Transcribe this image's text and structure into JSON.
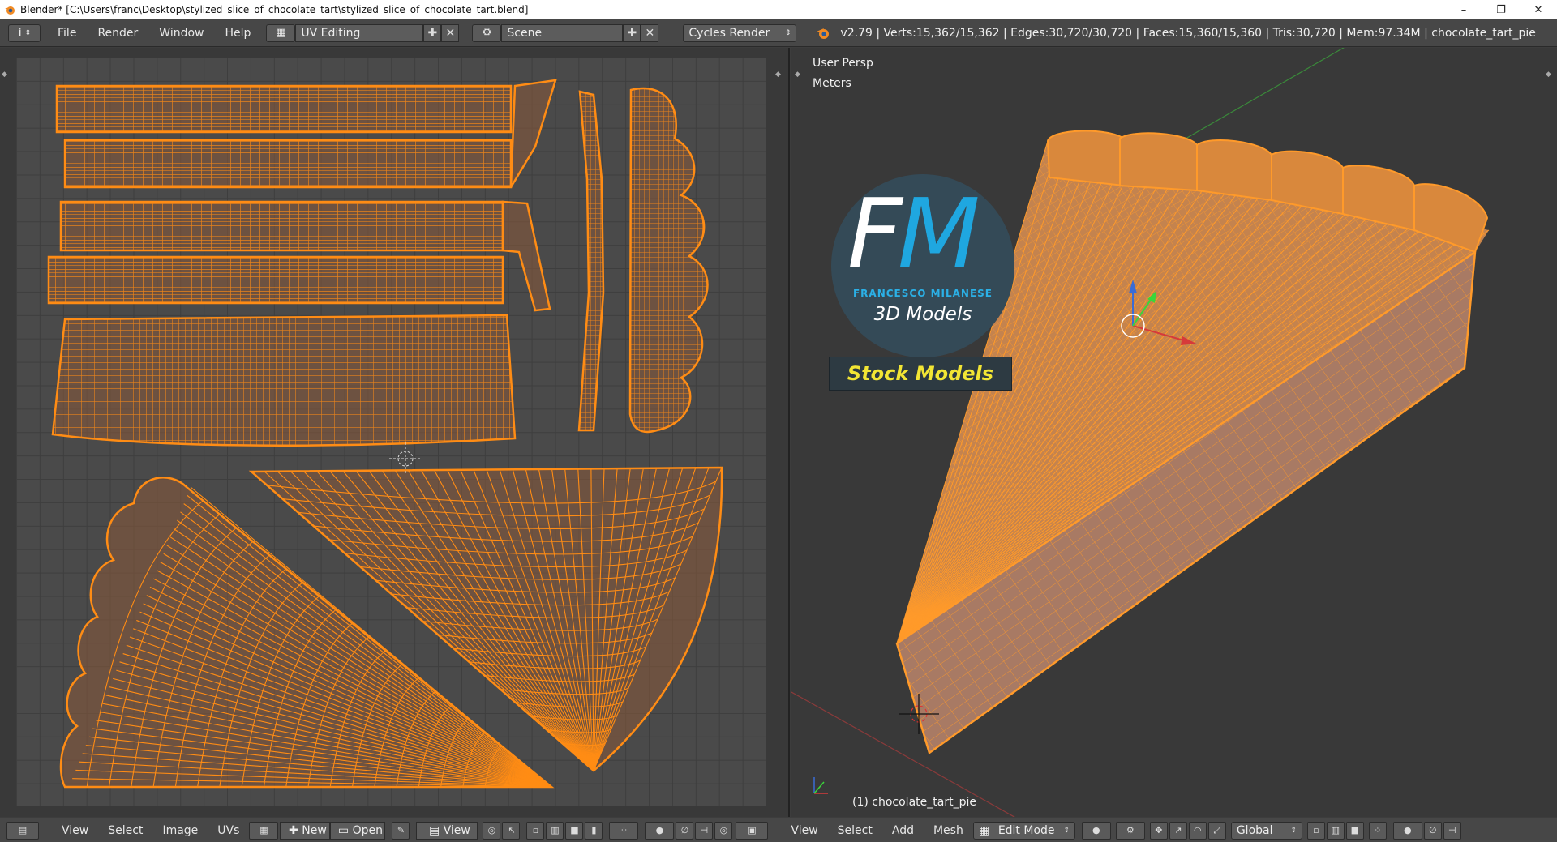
{
  "window": {
    "title": "Blender* [C:\\Users\\franc\\Desktop\\stylized_slice_of_chocolate_tart\\stylized_slice_of_chocolate_tart.blend]",
    "minimize": "–",
    "maximize": "❐",
    "close": "✕"
  },
  "header": {
    "info_icon": "i",
    "menus": [
      "File",
      "Render",
      "Window",
      "Help"
    ],
    "screen_layout": "UV Editing",
    "scene": "Scene",
    "render_engine": "Cycles Render",
    "stats": "v2.79 | Verts:15,362/15,362 | Edges:30,720/30,720 | Faces:15,360/15,360 | Tris:30,720 | Mem:97.34M | chocolate_tart_pie"
  },
  "viewport": {
    "view_name": "User Persp",
    "units": "Meters",
    "object_label": "(1) chocolate_tart_pie"
  },
  "logo": {
    "letter_f": "F",
    "letter_m": "M",
    "author": "FRANCESCO MILANESE",
    "tagline": "3D Models",
    "badge": "Stock Models"
  },
  "uv_footer": {
    "menus": [
      "View",
      "Select",
      "Image",
      "UVs"
    ],
    "new_label": "New",
    "open_label": "Open",
    "view_label": "View"
  },
  "vp_footer": {
    "menus": [
      "View",
      "Select",
      "Add",
      "Mesh"
    ],
    "mode": "Edit Mode",
    "orientation": "Global"
  },
  "colors": {
    "wire": "#ff8c14",
    "face": "#a87a60",
    "bg": "#393939"
  }
}
